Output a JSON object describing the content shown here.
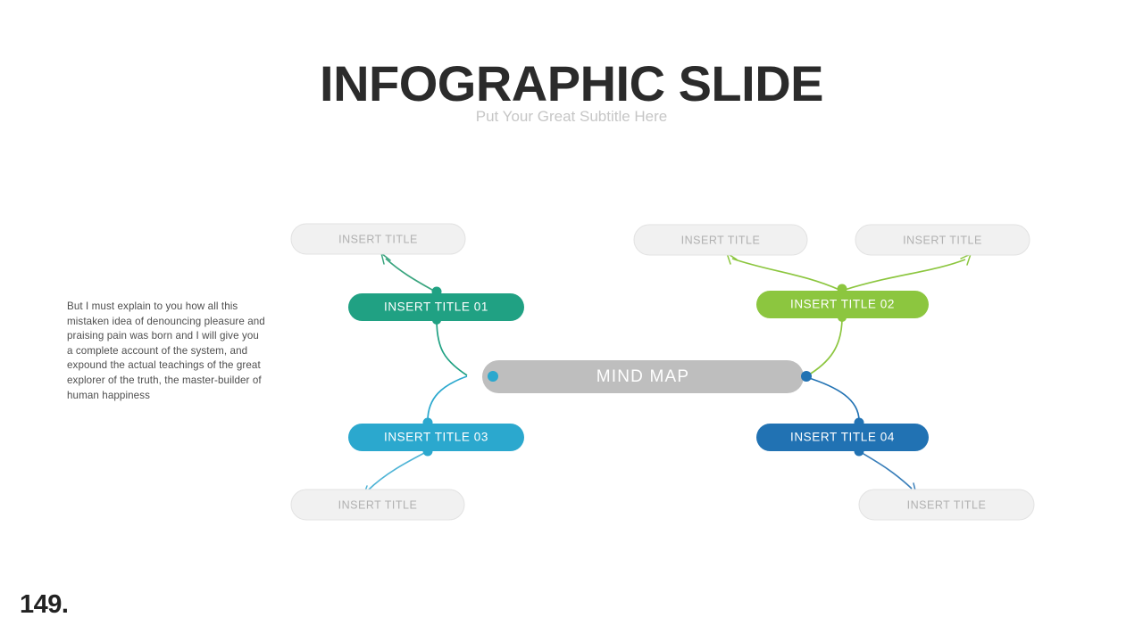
{
  "header": {
    "title": "INFOGRAPHIC SLIDE",
    "subtitle": "Put Your Great Subtitle Here"
  },
  "body": {
    "paragraph": "But I must explain to you how all this mistaken idea of denouncing pleasure and praising pain was born and I will give you a complete account of the system, and expound the actual teachings of the great explorer of the truth, the master-builder of human happiness"
  },
  "footer": {
    "page_number": "149."
  },
  "diagram": {
    "type": "mind-map",
    "center": {
      "label": "MIND MAP",
      "color": "#bebebe",
      "text_color": "#ffffff"
    },
    "branches": [
      {
        "id": "branch-01",
        "label": "INSERT TITLE 01",
        "color": "#20a183",
        "position": "top-left",
        "children": [
          {
            "label": "INSERT TITLE",
            "color": "#f1f1f1"
          }
        ]
      },
      {
        "id": "branch-02",
        "label": "INSERT TITLE 02",
        "color": "#8cc63f",
        "position": "top-right",
        "children": [
          {
            "label": "INSERT TITLE",
            "color": "#f1f1f1"
          },
          {
            "label": "INSERT TITLE",
            "color": "#f1f1f1"
          }
        ]
      },
      {
        "id": "branch-03",
        "label": "INSERT TITLE 03",
        "color": "#2ba8ce",
        "position": "bottom-left",
        "children": [
          {
            "label": "INSERT TITLE",
            "color": "#f1f1f1"
          }
        ]
      },
      {
        "id": "branch-04",
        "label": "INSERT TITLE 04",
        "color": "#2172b3",
        "position": "bottom-right",
        "children": [
          {
            "label": "INSERT TITLE",
            "color": "#f1f1f1"
          }
        ]
      }
    ]
  }
}
